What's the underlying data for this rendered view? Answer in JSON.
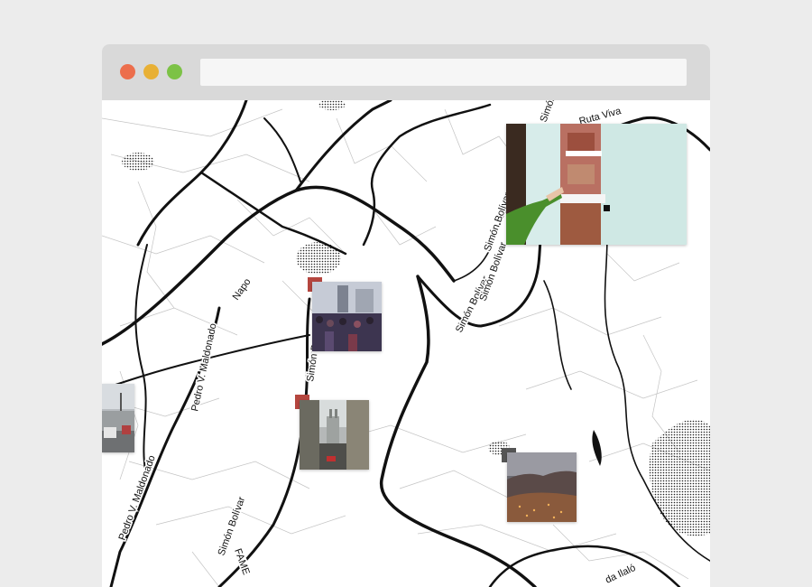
{
  "window": {
    "traffic_lights": [
      "#ec6e4c",
      "#e8b035",
      "#7cc246"
    ],
    "address_bar_value": ""
  },
  "map": {
    "street_labels": [
      "Napo",
      "Pedro V. Maldonado",
      "Pedro V. Maldonado",
      "Simón B",
      "Simón Bolívar",
      "Simón Bolívar",
      "Simón Bolívar",
      "Simón Bolívar",
      "Simón",
      "Ruta Viva",
      "FAME",
      "da Ilaló"
    ]
  },
  "photos": [
    {
      "name": "photo-touchscreen-exhibit",
      "description_icon": "touchscreen-photo"
    },
    {
      "name": "photo-crowd-street",
      "description_icon": "crowd-photo"
    },
    {
      "name": "photo-colonial-street-church",
      "description_icon": "street-photo"
    },
    {
      "name": "photo-city-dusk-aerial",
      "description_icon": "city-photo"
    },
    {
      "name": "photo-street-traffic",
      "description_icon": "traffic-photo"
    }
  ],
  "colors": {
    "background": "#ececec",
    "titlebar": "#d9d9d9",
    "address_bar": "#f6f6f6",
    "road_major": "#111111",
    "road_minor": "#bdbdbd",
    "pin_marker": "#b5463f"
  }
}
